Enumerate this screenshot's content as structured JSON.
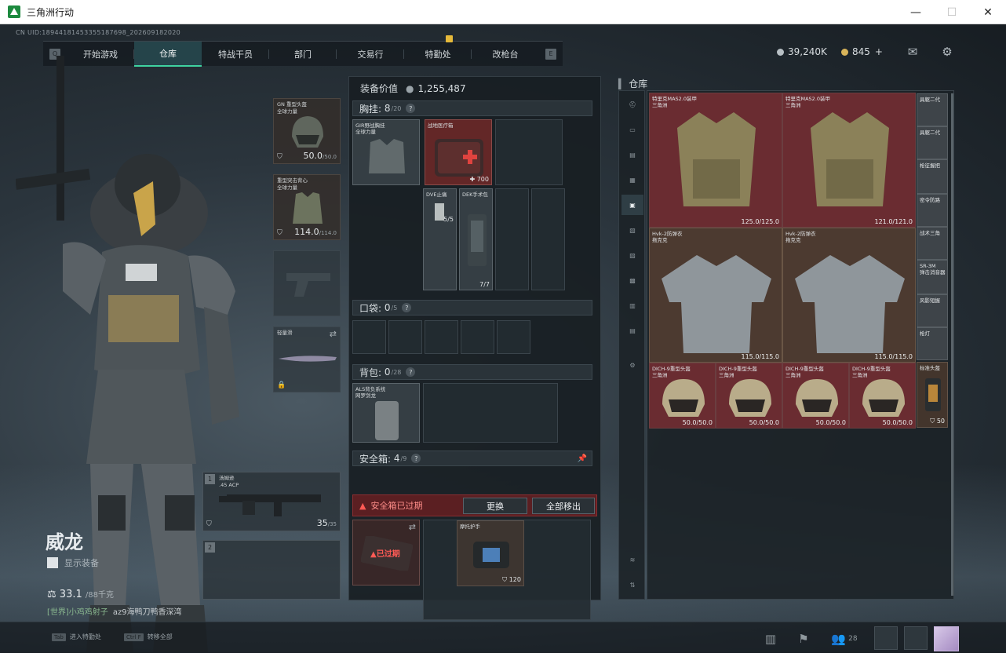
{
  "window": {
    "title": "三角洲行动",
    "controls": [
      "—",
      "☐",
      "✕"
    ]
  },
  "uid": "CN UID:18944181453355187698_202609182020",
  "nav": {
    "left_key": "Q",
    "right_key": "E",
    "tabs": [
      "开始游戏",
      "仓库",
      "特战干员",
      "部门",
      "交易行",
      "特勤处",
      "改枪台"
    ],
    "active": "仓库"
  },
  "currency": {
    "coins": "39,240K",
    "bonds": "845",
    "plus": "+"
  },
  "icons": {
    "mail": "mail-icon",
    "settings": "gear-icon"
  },
  "operator": {
    "name": "威龙",
    "show_equipment": "显示装备",
    "weight": "33.1",
    "weight_max": "/88千克",
    "chat_speaker": "[世界]小鸡鸡射子",
    "chat_text": "az9海鸭刀鸭香深湾"
  },
  "equipment": {
    "helmet": {
      "label": "GN 重型头盔\n全球力量",
      "value": "50.0",
      "max": "/50.0"
    },
    "armor": {
      "label": "重型突击背心\n全球力量",
      "value": "114.0",
      "max": "/114.0"
    },
    "melee": {
      "label": "轻量滑"
    },
    "weapon1": {
      "num": "1",
      "label": "汤姆逊\n.45 ACP",
      "ammo": "35",
      "ammo_max": "/35"
    },
    "weapon2": {
      "num": "2"
    }
  },
  "center": {
    "title": "装备价值",
    "value": "1,255,487",
    "chest": {
      "label": "胸挂:",
      "count": "8",
      "max": "/20"
    },
    "chest_items": [
      {
        "label": "GIR野战胸挂\n全球力量"
      },
      {
        "label": "战地医疗箱",
        "num": "700"
      },
      {
        "label": "DVE止痛",
        "num": "5/5"
      },
      {
        "label": "DEK手术包",
        "num": "7/7"
      }
    ],
    "pocket": {
      "label": "口袋:",
      "count": "0",
      "max": "/5"
    },
    "backpack": {
      "label": "背包:",
      "count": "0",
      "max": "/28"
    },
    "backpack_item": {
      "label": "ALS背负系统\n网罗剑龙"
    },
    "safebox": {
      "label": "安全箱:",
      "count": "4",
      "max": "/9"
    },
    "expired_text": "安全箱已过期",
    "swap_btn": "更换",
    "move_all_btn": "全部移出",
    "expired_badge": "已过期",
    "safebox_item": {
      "label": "摩托护手",
      "num": "120"
    },
    "q": "?"
  },
  "warehouse": {
    "title": "仓库",
    "items": [
      {
        "label": "特里克MAS2.0装甲\n三角洲",
        "value": "125.0/125.0"
      },
      {
        "label": "特里克MAS2.0装甲\n三角洲",
        "value": "121.0/121.0"
      },
      {
        "label": "Hvk-2防弹衣\n拖克克",
        "value": "115.0/115.0"
      },
      {
        "label": "Hvk-2防弹衣\n拖克克",
        "value": "115.0/115.0"
      },
      {
        "label": "DICH-9重型头盔\n三角洲",
        "value": "50.0/50.0"
      },
      {
        "label": "DICH-9重型头盔\n三角洲",
        "value": "50.0/50.0"
      },
      {
        "label": "DICH-9重型头盔\n三角洲",
        "value": "50.0/50.0"
      },
      {
        "label": "DICH-9重型头盔\n三角洲",
        "value": "50.0/50.0"
      }
    ],
    "small_items": [
      "具躯二代",
      "具躯二代",
      "枪征握把",
      "密令防路",
      "战术三角",
      "SR-3M\n弹击消音器",
      "风影短握",
      "枪灯",
      "标准头盔"
    ],
    "small_last_value": "50"
  },
  "bottom": {
    "hint1_key": "Tab",
    "hint1": "进入特勤处",
    "hint2_key": "Ctrl F",
    "hint2": "转移全部",
    "friends": "28"
  }
}
